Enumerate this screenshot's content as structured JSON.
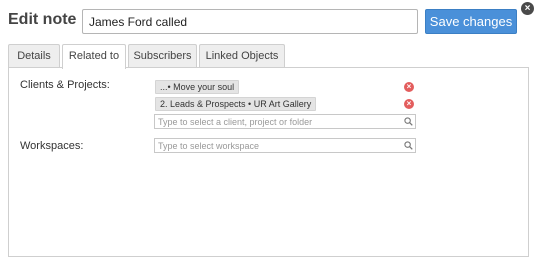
{
  "header": {
    "title": "Edit note",
    "note_title_value": "James Ford called",
    "save_label": "Save changes",
    "close_label": "×"
  },
  "tabs": [
    {
      "label": "Details",
      "active": false
    },
    {
      "label": "Related to",
      "active": true
    },
    {
      "label": "Subscribers",
      "active": false
    },
    {
      "label": "Linked Objects",
      "active": false
    }
  ],
  "related": {
    "clients_label": "Clients & Projects:",
    "items": [
      {
        "label": "...• Move your soul"
      },
      {
        "label": "2. Leads & Prospects • UR Art Gallery"
      }
    ],
    "client_placeholder": "Type to select a client, project or folder",
    "workspaces_label": "Workspaces:",
    "workspace_placeholder": "Type to select workspace"
  },
  "icons": {
    "close": "close-icon",
    "remove": "remove-icon",
    "search": "search-icon"
  },
  "colors": {
    "accent": "#4a90d9",
    "remove": "#e35d5d"
  }
}
